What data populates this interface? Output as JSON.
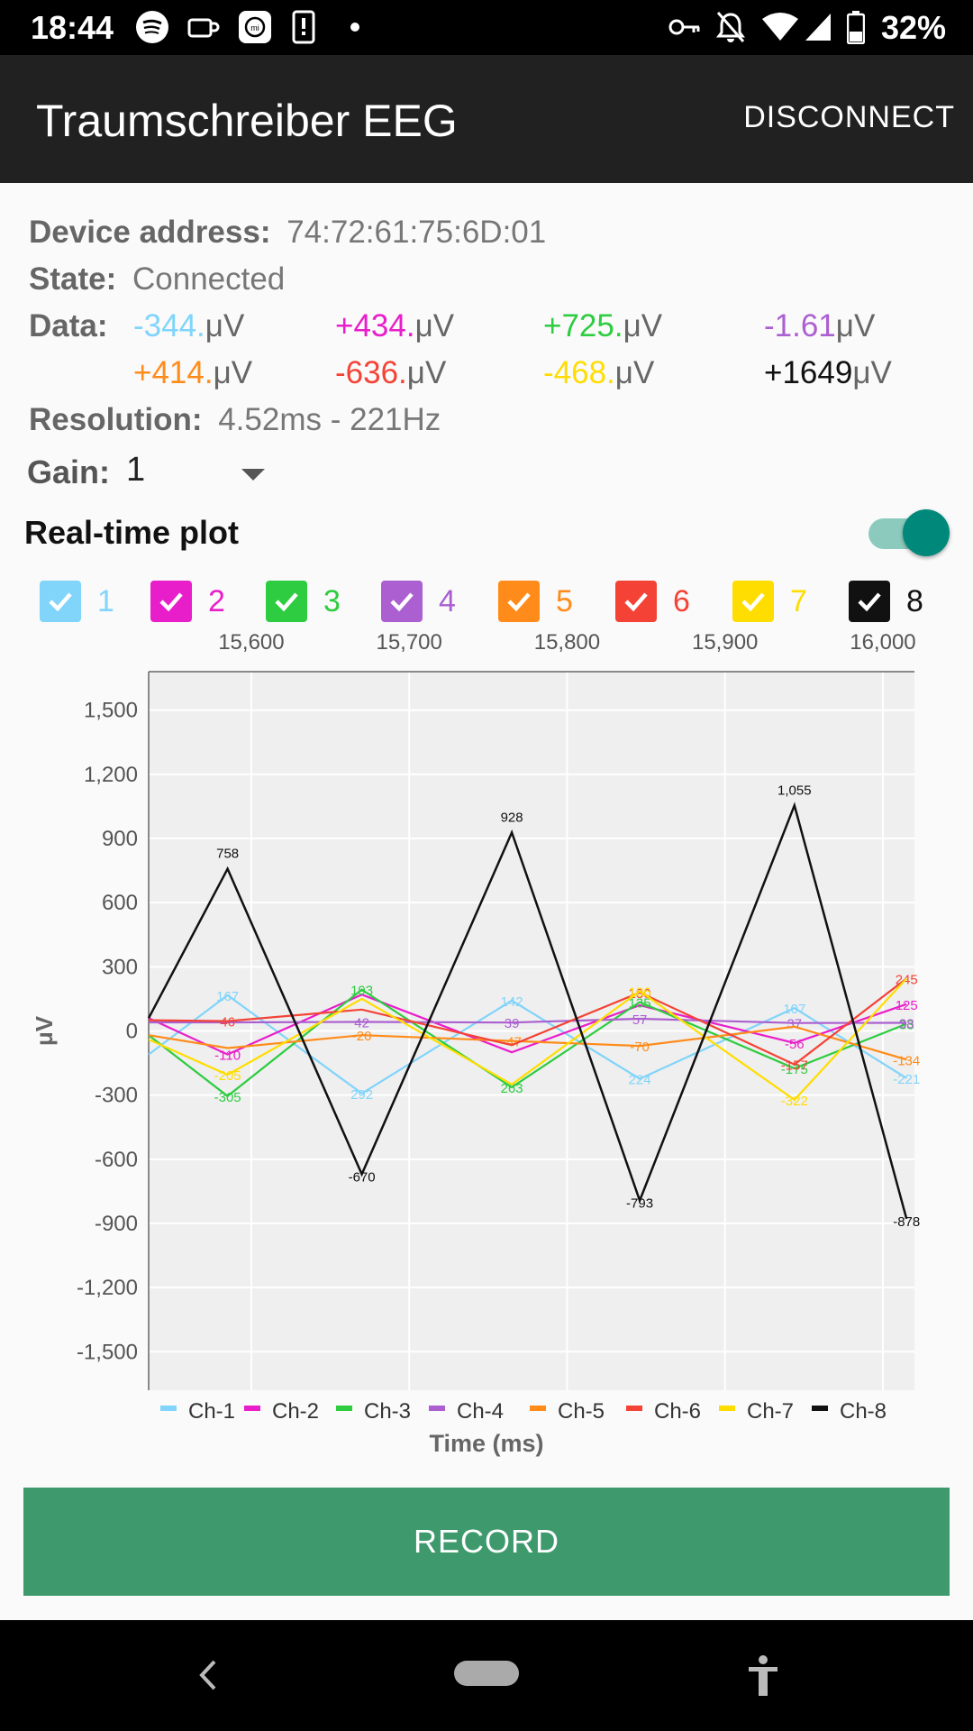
{
  "status_bar": {
    "time": "18:44",
    "battery": "32%"
  },
  "app_bar": {
    "title": "Traumschreiber EEG",
    "action": "DISCONNECT"
  },
  "info": {
    "device_label": "Device address:",
    "device_value": "74:72:61:75:6D:01",
    "state_label": "State:",
    "state_value": "Connected",
    "data_label": "Data:",
    "resolution_label": "Resolution:",
    "resolution_value": "4.52ms - 221Hz",
    "gain_label": "Gain:",
    "gain_value": "1"
  },
  "data_values": [
    {
      "value": "-344.",
      "unit": "μV",
      "color": "#81d4fa"
    },
    {
      "value": "+434.",
      "unit": "μV",
      "color": "#e91ecb"
    },
    {
      "value": "+725.",
      "unit": "μV",
      "color": "#2ecc40"
    },
    {
      "value": "-1.61",
      "unit": "μV",
      "color": "#ab5fd0"
    },
    {
      "value": "+414.",
      "unit": "μV",
      "color": "#ff8c1a"
    },
    {
      "value": "-636.",
      "unit": "μV",
      "color": "#f44336"
    },
    {
      "value": "-468.",
      "unit": "μV",
      "color": "#ffdd00"
    },
    {
      "value": "+1649",
      "unit": "μV",
      "color": "#111111"
    }
  ],
  "plot": {
    "label": "Real-time plot",
    "enabled": true
  },
  "channels": [
    {
      "label": "1",
      "color": "#81d4fa",
      "checked": true
    },
    {
      "label": "2",
      "color": "#e91ecb",
      "checked": true
    },
    {
      "label": "3",
      "color": "#2ecc40",
      "checked": true
    },
    {
      "label": "4",
      "color": "#ab5fd0",
      "checked": true
    },
    {
      "label": "5",
      "color": "#ff8c1a",
      "checked": true
    },
    {
      "label": "6",
      "color": "#f44336",
      "checked": true
    },
    {
      "label": "7",
      "color": "#ffdd00",
      "checked": true
    },
    {
      "label": "8",
      "color": "#111111",
      "checked": true
    }
  ],
  "chart_data": {
    "type": "line",
    "xlabel": "Time (ms)",
    "ylabel": "μV",
    "xlim": [
      15535,
      16020
    ],
    "ylim": [
      -1680,
      1680
    ],
    "xticks": [
      15600,
      15700,
      15800,
      15900,
      16000
    ],
    "xtick_labels": [
      "15,600",
      "15,700",
      "15,800",
      "15,900",
      "16,000"
    ],
    "yticks": [
      1500,
      1200,
      900,
      600,
      300,
      0,
      -300,
      -600,
      -900,
      -1200,
      -1500
    ],
    "ytick_labels": [
      "1,500",
      "1,200",
      "900",
      "600",
      "300",
      "0",
      "-300",
      "-600",
      "-900",
      "-1,200",
      "-1,500"
    ],
    "grid": true,
    "legend": "bottom",
    "x": [
      15535,
      15585,
      15670,
      15765,
      15846,
      15944,
      16015
    ],
    "series": [
      {
        "name": "Ch-1",
        "color": "#81d4fa",
        "values": [
          -110,
          167,
          -292,
          142,
          -224,
          107,
          -221
        ],
        "labels": [
          "",
          "167",
          "292",
          "142",
          "224",
          "107",
          "-221"
        ]
      },
      {
        "name": "Ch-2",
        "color": "#e91ecb",
        "values": [
          60,
          -110,
          170,
          -100,
          120,
          -56,
          125
        ],
        "labels": [
          "",
          "-110",
          "",
          "",
          "",
          "-56",
          "125"
        ]
      },
      {
        "name": "Ch-3",
        "color": "#2ecc40",
        "values": [
          -20,
          -305,
          193,
          -263,
          135,
          -175,
          33
        ],
        "labels": [
          "",
          "-305",
          "193",
          "263",
          "135",
          "-175",
          "33"
        ]
      },
      {
        "name": "Ch-4",
        "color": "#ab5fd0",
        "values": [
          40,
          40,
          42,
          39,
          57,
          37,
          38
        ],
        "labels": [
          "",
          "",
          "42",
          "39",
          "57",
          "37",
          "38"
        ]
      },
      {
        "name": "Ch-5",
        "color": "#ff8c1a",
        "values": [
          -20,
          -80,
          -20,
          -47,
          -70,
          20,
          -134
        ],
        "labels": [
          "",
          "",
          "-20",
          "-47",
          "-70",
          "",
          "-134"
        ]
      },
      {
        "name": "Ch-6",
        "color": "#f44336",
        "values": [
          50,
          46,
          100,
          -66,
          180,
          -157,
          245
        ],
        "labels": [
          "",
          "46",
          "",
          "",
          "180",
          "-157",
          "245"
        ]
      },
      {
        "name": "Ch-7",
        "color": "#ffdd00",
        "values": [
          -40,
          -205,
          150,
          -250,
          186,
          -322,
          245
        ],
        "labels": [
          "",
          "-205",
          "",
          "",
          "186",
          "-322",
          ""
        ]
      },
      {
        "name": "Ch-8",
        "color": "#111111",
        "values": [
          60,
          758,
          -670,
          928,
          -793,
          1055,
          -878
        ],
        "labels": [
          "",
          "758",
          "-670",
          "928",
          "-793",
          "1,055",
          "-878"
        ]
      }
    ]
  },
  "record_label": "RECORD"
}
